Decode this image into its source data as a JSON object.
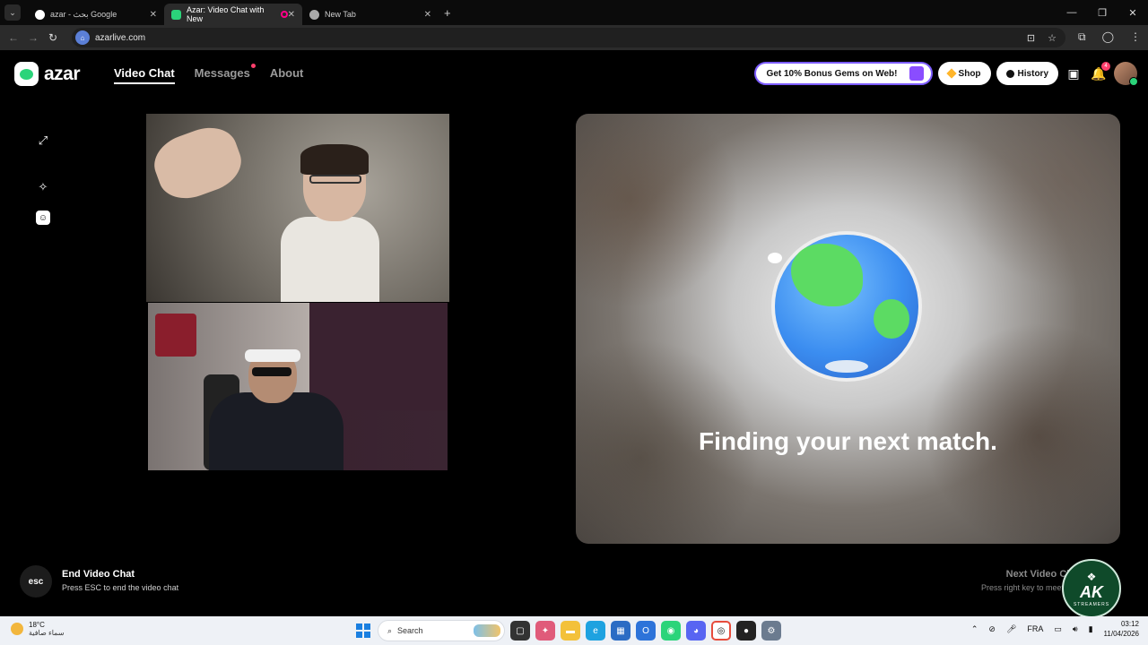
{
  "browser": {
    "tabs": [
      {
        "title": "azar - بحث Google",
        "active": false
      },
      {
        "title": "Azar: Video Chat with New",
        "active": true
      },
      {
        "title": "New Tab",
        "active": false
      }
    ],
    "url": "azarlive.com"
  },
  "site": {
    "logo_text": "azar",
    "nav": [
      "Video Chat",
      "Messages",
      "About"
    ],
    "promo": "Get 10% Bonus Gems on Web!",
    "shop": "Shop",
    "history": "History",
    "notification_count": "4"
  },
  "match": {
    "status": "Finding your next match."
  },
  "hints": {
    "esc_key": "esc",
    "end_title": "End Video Chat",
    "end_sub": "Press ESC to end the video chat",
    "next_title": "Next Video Ch",
    "next_sub": "Press right key to meet ot"
  },
  "watermark": {
    "big": "AK",
    "small": "STREAMERS"
  },
  "taskbar": {
    "temp": "18°C",
    "condition": "سماء صافية",
    "search_placeholder": "Search",
    "lang": "FRA",
    "time": "03:12",
    "date": "11/04/2026"
  },
  "colors": {
    "brand_green": "#2bd47a",
    "badge_red": "#ff3f6c",
    "promo_border": "#7c5cff"
  }
}
